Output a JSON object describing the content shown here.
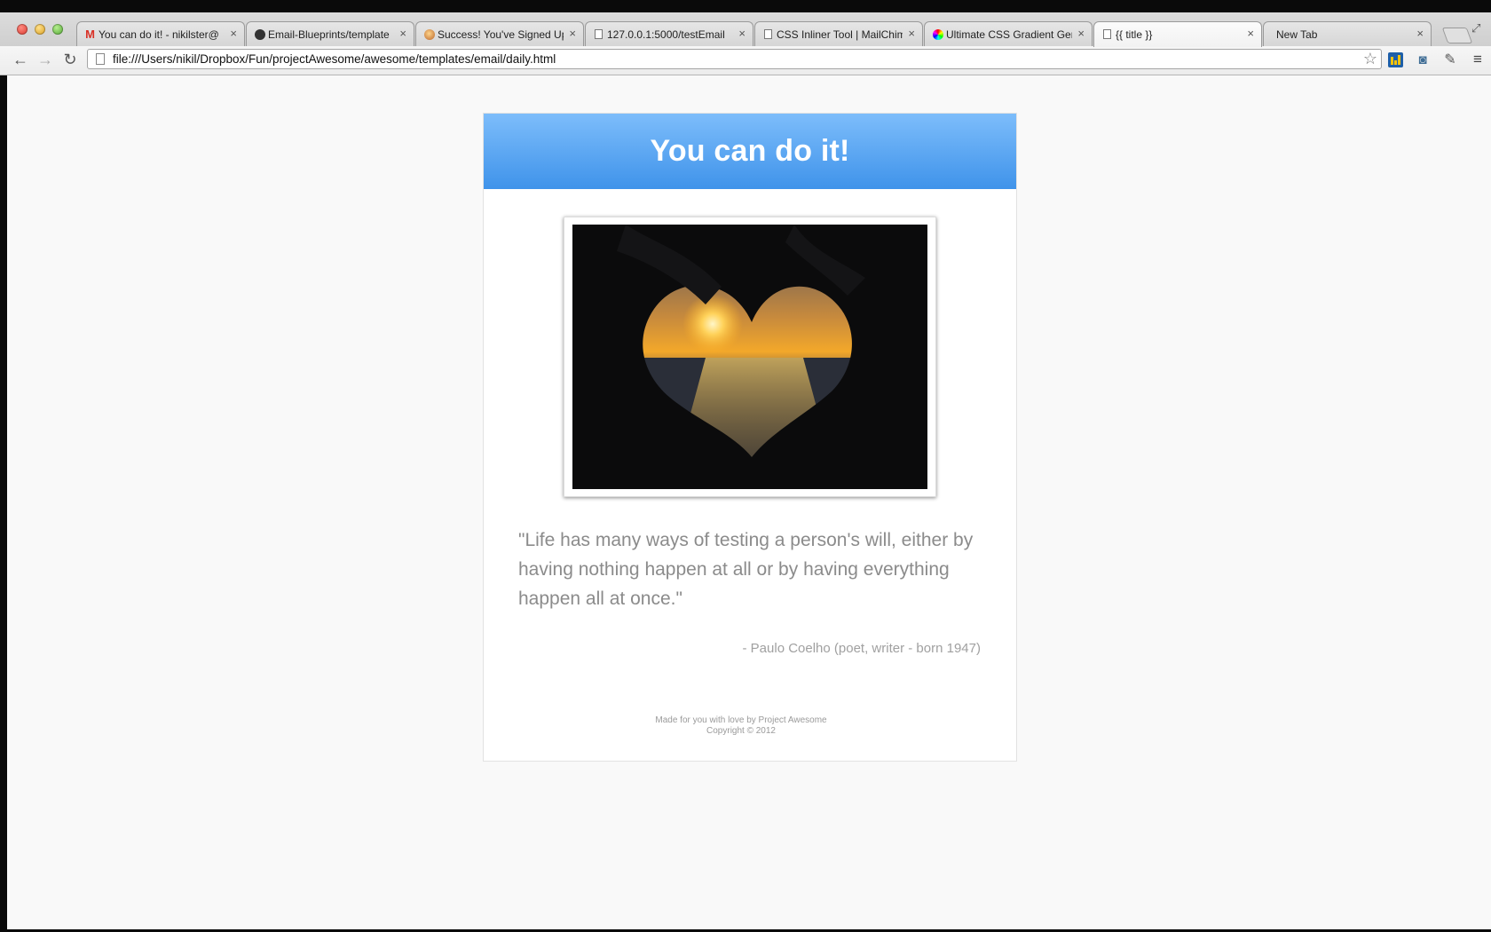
{
  "browser": {
    "tabs": [
      {
        "title": "You can do it! - nikilster@",
        "favicon": "gmail-icon",
        "active": false
      },
      {
        "title": "Email-Blueprints/template",
        "favicon": "github-icon",
        "active": false
      },
      {
        "title": "Success! You've Signed Up",
        "favicon": "mailchimp-icon",
        "active": false
      },
      {
        "title": "127.0.0.1:5000/testEmail",
        "favicon": "page-icon",
        "active": false
      },
      {
        "title": "CSS Inliner Tool | MailChim",
        "favicon": "page-icon",
        "active": false
      },
      {
        "title": "Ultimate CSS Gradient Gen",
        "favicon": "color-wheel-icon",
        "active": false
      },
      {
        "title": "{{ title }}",
        "favicon": "page-icon",
        "active": true
      },
      {
        "title": "New Tab",
        "favicon": "",
        "active": false
      }
    ],
    "close_glyph": "×",
    "url": "file:///Users/nikil/Dropbox/Fun/projectAwesome/awesome/templates/email/daily.html"
  },
  "email": {
    "title": "You can do it!",
    "quote": "\"Life has many ways of testing a person's will, either by having nothing happen at all or by having everything happen all at once.\"",
    "attribution": "- Paulo Coelho (poet, writer - born 1947)",
    "footer_line1": "Made for you with love by Project Awesome",
    "footer_line2": "Copyright © 2012"
  },
  "colors": {
    "header_top": "#7dbdfb",
    "header_bottom": "#3f93ea",
    "quote_text": "#8b8b8b"
  }
}
